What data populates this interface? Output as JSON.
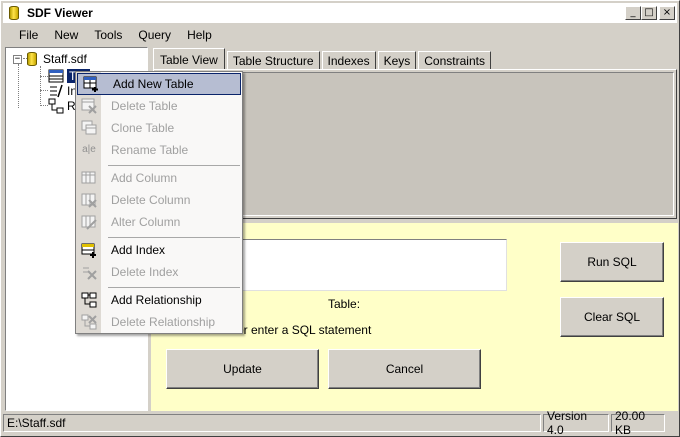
{
  "window": {
    "title": "SDF Viewer"
  },
  "menu": [
    "File",
    "New",
    "Tools",
    "Query",
    "Help"
  ],
  "title_buttons": {
    "minimize": "_",
    "maximize": "□",
    "close": "×"
  },
  "tree": {
    "root_label": "Staff.sdf",
    "children": [
      {
        "label": "Tables",
        "visible": "Tab"
      },
      {
        "label": "In",
        "visible": "In"
      },
      {
        "label": "R",
        "visible": "R"
      }
    ]
  },
  "tabs": [
    "Table View",
    "Table Structure",
    "Indexes",
    "Keys",
    "Constraints"
  ],
  "sql": {
    "table_label": "Table:",
    "hint": "or enter a SQL statement",
    "run_button": "Run SQL",
    "clear_button": "Clear SQL",
    "update_button": "Update",
    "cancel_button": "Cancel"
  },
  "context_menu": {
    "items": [
      {
        "label": "Add New Table",
        "icon": "add-table-icon",
        "enabled": true,
        "highlighted": true
      },
      {
        "label": "Delete Table",
        "icon": "delete-table-icon",
        "enabled": false
      },
      {
        "label": "Clone Table",
        "icon": "clone-table-icon",
        "enabled": false
      },
      {
        "label": "Rename Table",
        "icon": "rename-table-icon",
        "enabled": false
      },
      {
        "label": "Add Column",
        "icon": "add-column-icon",
        "enabled": false
      },
      {
        "label": "Delete Column",
        "icon": "delete-column-icon",
        "enabled": false
      },
      {
        "label": "Alter Column",
        "icon": "alter-column-icon",
        "enabled": false
      },
      {
        "label": "Add Index",
        "icon": "add-index-icon",
        "enabled": true
      },
      {
        "label": "Delete Index",
        "icon": "delete-index-icon",
        "enabled": false
      },
      {
        "label": "Add Relationship",
        "icon": "add-relationship-icon",
        "enabled": true
      },
      {
        "label": "Delete Relationship",
        "icon": "delete-relationship-icon",
        "enabled": false
      }
    ],
    "rename_icon_text": "a|e"
  },
  "status": {
    "path": "E:\\Staff.sdf",
    "version": "Version 4.0",
    "size": "20.00 KB"
  },
  "colors": {
    "sql_background": "#ffffc8",
    "selection": "#0a246a",
    "menu_highlight": "#b6bdd2"
  }
}
